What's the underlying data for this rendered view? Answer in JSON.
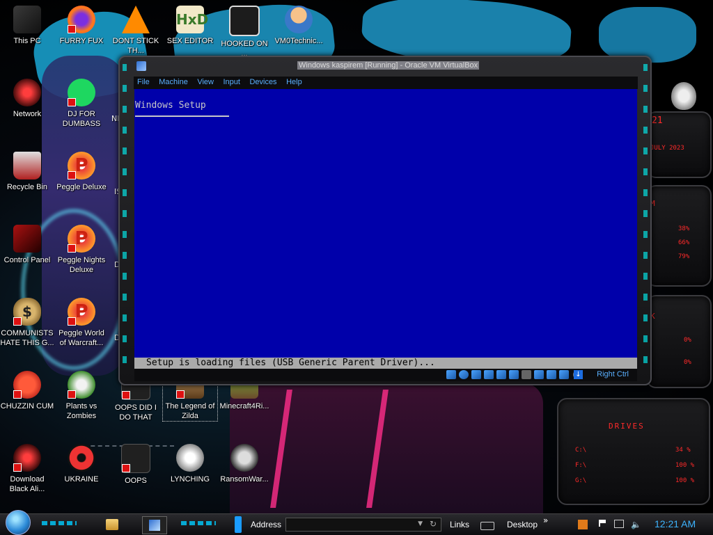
{
  "desktop_icons": [
    {
      "label": "This PC",
      "icon": "computer-icon"
    },
    {
      "label": "FURRY FUX",
      "icon": "firefox-icon"
    },
    {
      "label": "DONT STICK TH...",
      "icon": "vlc-icon"
    },
    {
      "label": "SEX EDITOR",
      "icon": "hxd-icon"
    },
    {
      "label": "HOOKED ON ...",
      "icon": "game-icon"
    },
    {
      "label": "VM0Technic...",
      "icon": "doctor-icon"
    },
    {
      "label": "Network",
      "icon": "network-icon"
    },
    {
      "label": "DJ FOR DUMBASS",
      "icon": "spotify-icon"
    },
    {
      "label": "Recycle Bin",
      "icon": "recycle-bin-icon"
    },
    {
      "label": "Peggle Deluxe",
      "icon": "peggle-icon"
    },
    {
      "label": "Control Panel",
      "icon": "control-panel-icon"
    },
    {
      "label": "Peggle Nights Deluxe",
      "icon": "peggle-icon"
    },
    {
      "label": "COMMUNISTS HATE THIS G...",
      "icon": "money-bag-icon"
    },
    {
      "label": "Peggle World of Warcraft...",
      "icon": "peggle-icon"
    },
    {
      "label": "CHUZZIN CUM",
      "icon": "chuzzle-icon"
    },
    {
      "label": "Plants vs Zombies",
      "icon": "pvz-icon"
    },
    {
      "label": "OOPS DID I DO THAT",
      "icon": "oops-icon"
    },
    {
      "label": "The Legend of Zilda",
      "icon": "zelda-icon"
    },
    {
      "label": "Minecraft4Ri...",
      "icon": "minecraft-icon"
    },
    {
      "label": "Download Black Ali...",
      "icon": "alienware-icon"
    },
    {
      "label": "UKRAINE",
      "icon": "radiation-icon"
    },
    {
      "label": "OOPS",
      "icon": "oops-icon"
    },
    {
      "label": "LYNCHING",
      "icon": "lynching-icon"
    },
    {
      "label": "RansomWar...",
      "icon": "skull-icon"
    }
  ],
  "partial_labels": {
    "ne": "NE",
    "is": "IS",
    "di": "DI",
    "d": "D"
  },
  "vbox": {
    "title": "Windows kaspirem [Running] - Oracle VM VirtualBox",
    "menu": [
      "File",
      "Machine",
      "View",
      "Input",
      "Devices",
      "Help"
    ],
    "host_key": "Right Ctrl"
  },
  "guest": {
    "setup_title": "Windows Setup",
    "status": "Setup is loading files (USB Generic Parent Driver)..."
  },
  "gadgets": {
    "date_fragment": "JULY 2023",
    "day_fragment": "21",
    "cpu_values": [
      "38%",
      "66%",
      "79%"
    ],
    "net_values": [
      "0%",
      "0%"
    ],
    "drives_title": "DRIVES",
    "drives": [
      {
        "letter": "C:\\",
        "value": "34 %"
      },
      {
        "letter": "F:\\",
        "value": "100 %"
      },
      {
        "letter": "G:\\",
        "value": "100 %"
      }
    ]
  },
  "taskbar": {
    "address_label": "Address",
    "address_value": "",
    "links_label": "Links",
    "desktop_label": "Desktop",
    "clock": "12:21 AM"
  },
  "colors": {
    "guest_blue": "#0000aa",
    "guest_status_gray": "#aaaaaa",
    "vbox_menu_text": "#5ab0ff",
    "clock_blue": "#3db4ff",
    "alienware_red": "#ff2a2a"
  }
}
